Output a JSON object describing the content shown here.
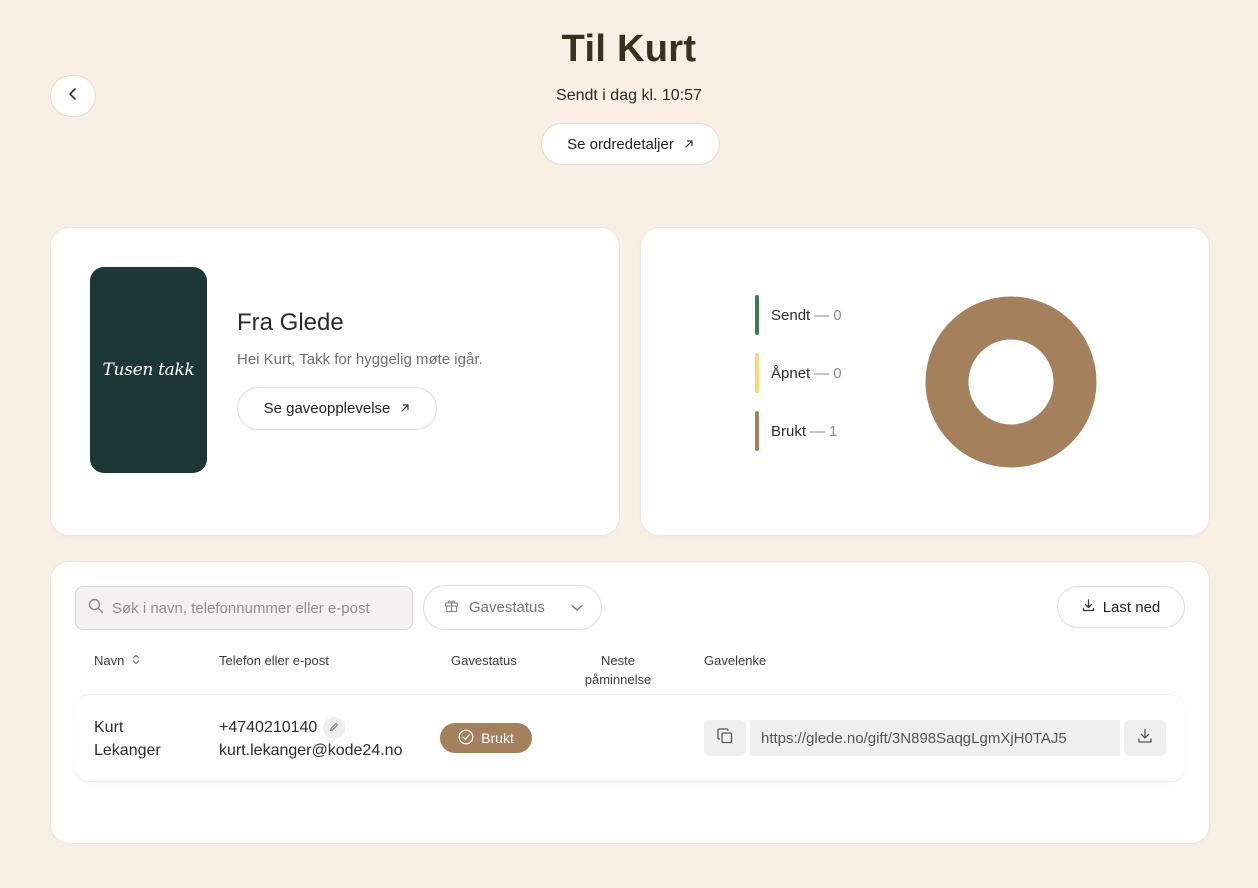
{
  "header": {
    "title": "Til Kurt",
    "subtitle": "Sendt i dag kl. 10:57",
    "order_details_label": "Se ordredetaljer",
    "back_icon": "chevron-left-icon"
  },
  "gift": {
    "image_text": "Tusen takk",
    "from": "Fra Glede",
    "message": "Hei Kurt, Takk for hyggelig møte igår.",
    "experience_label": "Se gaveopplevelse",
    "image_color": "#1d3636"
  },
  "stats": {
    "separator": "—",
    "items": [
      {
        "label": "Sendt",
        "count": "0",
        "color": "#3e7a57"
      },
      {
        "label": "Åpnet",
        "count": "0",
        "color": "#f2db7a"
      },
      {
        "label": "Brukt",
        "count": "1",
        "color": "#a4805c"
      }
    ],
    "donut_values": [
      0,
      0,
      1
    ]
  },
  "table": {
    "search_placeholder": "Søk i navn, telefonnummer eller e-post",
    "status_filter_label": "Gavestatus",
    "download_label": "Last ned",
    "columns": {
      "name": "Navn",
      "contact": "Telefon eller e-post",
      "status": "Gavestatus",
      "reminder_line1": "Neste",
      "reminder_line2": "påminnelse",
      "link": "Gavelenke"
    },
    "rows": [
      {
        "first_name": "Kurt",
        "last_name": "Lekanger",
        "phone": "+4740210140",
        "email": "kurt.lekanger@kode24.no",
        "status": "Brukt",
        "next_reminder": "",
        "link": "https://glede.no/gift/3N898SaqgLgmXjH0TAJ5"
      }
    ]
  }
}
